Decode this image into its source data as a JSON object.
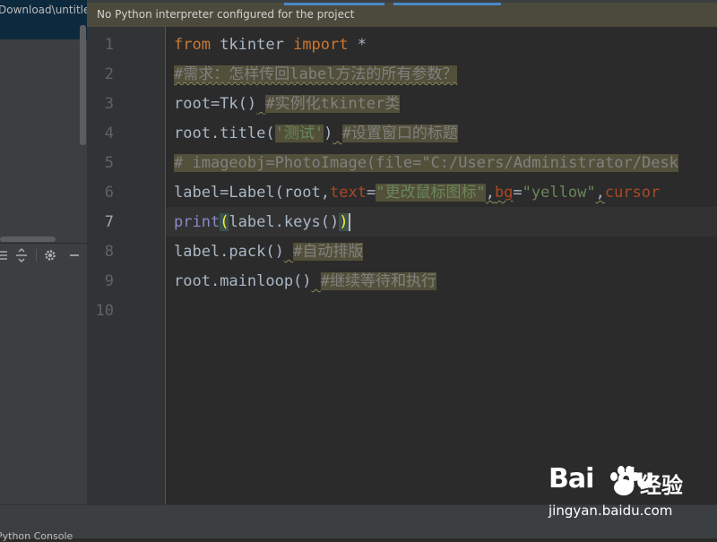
{
  "project_panel": {
    "path": "Download\\untitle"
  },
  "toolbar": {
    "collapse_icon": "collapse-all-icon",
    "expand_icon": "expand-all-icon",
    "settings_icon": "gear-icon",
    "hide_icon": "minus-icon"
  },
  "banner": {
    "text": "No Python interpreter configured for the project"
  },
  "editor": {
    "line_numbers": [
      "1",
      "2",
      "3",
      "4",
      "5",
      "6",
      "7",
      "8",
      "9",
      "10"
    ],
    "current_line": 7,
    "lines": {
      "l1_kw1": "from",
      "l1_mod": " tkinter ",
      "l1_kw2": "import",
      "l1_star": " *",
      "l2_comment": "#需求：怎样传回label方法的所有参数？",
      "l3_code": "root=Tk()",
      "l3_comment": "#实例化tkinter类",
      "l4_code": "root.title(",
      "l4_str": "'测试'",
      "l4_close": ")",
      "l4_comment": "#设置窗口的标题",
      "l5_comment": "# imageobj=PhotoImage(file=\"C:/Users/Administrator/Desk",
      "l6_a": "label=Label(root,",
      "l6_text_kw": "text",
      "l6_eq1": "=",
      "l6_str1": "\"更改鼠标图标\"",
      "l6_comma": ",",
      "l6_bg_kw": "bg",
      "l6_eq2": "=",
      "l6_str2": "\"yellow\"",
      "l6_comma2": ",",
      "l6_cursor": "cursor",
      "l7_fn": "print",
      "l7_open": "(",
      "l7_mid": "label.keys()",
      "l7_close": ")",
      "l8_code": "label.pack()",
      "l8_comment": "#自动排版",
      "l9_code": "root.mainloop()",
      "l9_comment": "#继续等待和执行"
    }
  },
  "status": {
    "bottom_text": "Python Console"
  },
  "watermark": {
    "brand": "Bai",
    "brand2": "du",
    "cn": "经验",
    "url": "jingyan.baidu.com"
  }
}
